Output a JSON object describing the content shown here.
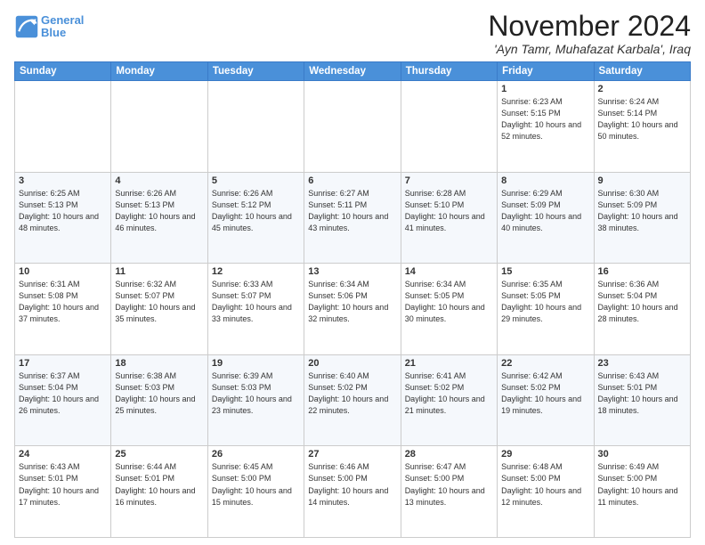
{
  "header": {
    "logo_line1": "General",
    "logo_line2": "Blue",
    "month": "November 2024",
    "location": "'Ayn Tamr, Muhafazat Karbala', Iraq"
  },
  "days_of_week": [
    "Sunday",
    "Monday",
    "Tuesday",
    "Wednesday",
    "Thursday",
    "Friday",
    "Saturday"
  ],
  "weeks": [
    [
      {
        "day": "",
        "info": ""
      },
      {
        "day": "",
        "info": ""
      },
      {
        "day": "",
        "info": ""
      },
      {
        "day": "",
        "info": ""
      },
      {
        "day": "",
        "info": ""
      },
      {
        "day": "1",
        "info": "Sunrise: 6:23 AM\nSunset: 5:15 PM\nDaylight: 10 hours and 52 minutes."
      },
      {
        "day": "2",
        "info": "Sunrise: 6:24 AM\nSunset: 5:14 PM\nDaylight: 10 hours and 50 minutes."
      }
    ],
    [
      {
        "day": "3",
        "info": "Sunrise: 6:25 AM\nSunset: 5:13 PM\nDaylight: 10 hours and 48 minutes."
      },
      {
        "day": "4",
        "info": "Sunrise: 6:26 AM\nSunset: 5:13 PM\nDaylight: 10 hours and 46 minutes."
      },
      {
        "day": "5",
        "info": "Sunrise: 6:26 AM\nSunset: 5:12 PM\nDaylight: 10 hours and 45 minutes."
      },
      {
        "day": "6",
        "info": "Sunrise: 6:27 AM\nSunset: 5:11 PM\nDaylight: 10 hours and 43 minutes."
      },
      {
        "day": "7",
        "info": "Sunrise: 6:28 AM\nSunset: 5:10 PM\nDaylight: 10 hours and 41 minutes."
      },
      {
        "day": "8",
        "info": "Sunrise: 6:29 AM\nSunset: 5:09 PM\nDaylight: 10 hours and 40 minutes."
      },
      {
        "day": "9",
        "info": "Sunrise: 6:30 AM\nSunset: 5:09 PM\nDaylight: 10 hours and 38 minutes."
      }
    ],
    [
      {
        "day": "10",
        "info": "Sunrise: 6:31 AM\nSunset: 5:08 PM\nDaylight: 10 hours and 37 minutes."
      },
      {
        "day": "11",
        "info": "Sunrise: 6:32 AM\nSunset: 5:07 PM\nDaylight: 10 hours and 35 minutes."
      },
      {
        "day": "12",
        "info": "Sunrise: 6:33 AM\nSunset: 5:07 PM\nDaylight: 10 hours and 33 minutes."
      },
      {
        "day": "13",
        "info": "Sunrise: 6:34 AM\nSunset: 5:06 PM\nDaylight: 10 hours and 32 minutes."
      },
      {
        "day": "14",
        "info": "Sunrise: 6:34 AM\nSunset: 5:05 PM\nDaylight: 10 hours and 30 minutes."
      },
      {
        "day": "15",
        "info": "Sunrise: 6:35 AM\nSunset: 5:05 PM\nDaylight: 10 hours and 29 minutes."
      },
      {
        "day": "16",
        "info": "Sunrise: 6:36 AM\nSunset: 5:04 PM\nDaylight: 10 hours and 28 minutes."
      }
    ],
    [
      {
        "day": "17",
        "info": "Sunrise: 6:37 AM\nSunset: 5:04 PM\nDaylight: 10 hours and 26 minutes."
      },
      {
        "day": "18",
        "info": "Sunrise: 6:38 AM\nSunset: 5:03 PM\nDaylight: 10 hours and 25 minutes."
      },
      {
        "day": "19",
        "info": "Sunrise: 6:39 AM\nSunset: 5:03 PM\nDaylight: 10 hours and 23 minutes."
      },
      {
        "day": "20",
        "info": "Sunrise: 6:40 AM\nSunset: 5:02 PM\nDaylight: 10 hours and 22 minutes."
      },
      {
        "day": "21",
        "info": "Sunrise: 6:41 AM\nSunset: 5:02 PM\nDaylight: 10 hours and 21 minutes."
      },
      {
        "day": "22",
        "info": "Sunrise: 6:42 AM\nSunset: 5:02 PM\nDaylight: 10 hours and 19 minutes."
      },
      {
        "day": "23",
        "info": "Sunrise: 6:43 AM\nSunset: 5:01 PM\nDaylight: 10 hours and 18 minutes."
      }
    ],
    [
      {
        "day": "24",
        "info": "Sunrise: 6:43 AM\nSunset: 5:01 PM\nDaylight: 10 hours and 17 minutes."
      },
      {
        "day": "25",
        "info": "Sunrise: 6:44 AM\nSunset: 5:01 PM\nDaylight: 10 hours and 16 minutes."
      },
      {
        "day": "26",
        "info": "Sunrise: 6:45 AM\nSunset: 5:00 PM\nDaylight: 10 hours and 15 minutes."
      },
      {
        "day": "27",
        "info": "Sunrise: 6:46 AM\nSunset: 5:00 PM\nDaylight: 10 hours and 14 minutes."
      },
      {
        "day": "28",
        "info": "Sunrise: 6:47 AM\nSunset: 5:00 PM\nDaylight: 10 hours and 13 minutes."
      },
      {
        "day": "29",
        "info": "Sunrise: 6:48 AM\nSunset: 5:00 PM\nDaylight: 10 hours and 12 minutes."
      },
      {
        "day": "30",
        "info": "Sunrise: 6:49 AM\nSunset: 5:00 PM\nDaylight: 10 hours and 11 minutes."
      }
    ]
  ]
}
